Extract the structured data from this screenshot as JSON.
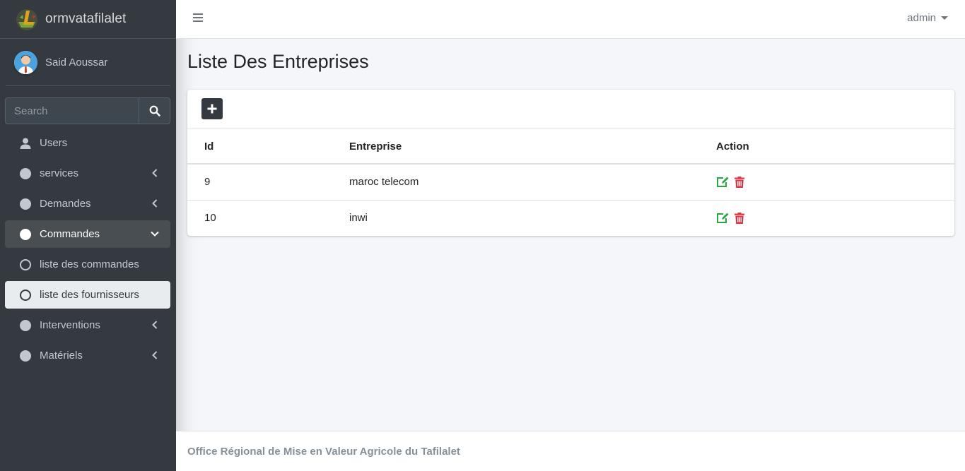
{
  "brand": {
    "name": "ormvatafilalet",
    "logo_icon": "brand-logo-icon"
  },
  "user": {
    "name": "Said Aoussar"
  },
  "search": {
    "placeholder": "Search"
  },
  "sidebar": {
    "items": [
      {
        "label": "Users",
        "icon": "user-icon",
        "state": "default"
      },
      {
        "label": "services",
        "icon": "circle-icon",
        "state": "collapsed"
      },
      {
        "label": "Demandes",
        "icon": "circle-icon",
        "state": "collapsed"
      },
      {
        "label": "Commandes",
        "icon": "circle-icon",
        "state": "open"
      },
      {
        "label": "liste des commandes",
        "icon": "circle-outline-icon",
        "state": "default"
      },
      {
        "label": "liste des fournisseurs",
        "icon": "circle-outline-icon",
        "state": "active"
      },
      {
        "label": "Interventions",
        "icon": "circle-icon",
        "state": "collapsed"
      },
      {
        "label": "Matériels",
        "icon": "circle-icon",
        "state": "collapsed"
      }
    ]
  },
  "topbar": {
    "user_menu": "admin"
  },
  "main": {
    "title": "Liste Des Entreprises",
    "table": {
      "headers": [
        "Id",
        "Entreprise",
        "Action"
      ],
      "rows": [
        {
          "id": "9",
          "entreprise": "maroc telecom"
        },
        {
          "id": "10",
          "entreprise": "inwi"
        }
      ]
    }
  },
  "footer": {
    "text": "Office Régional de Mise en Valeur Agricole du Tafilalet"
  },
  "colors": {
    "sidebar": "#343a40",
    "edit": "#28a745",
    "delete": "#dc3545"
  }
}
